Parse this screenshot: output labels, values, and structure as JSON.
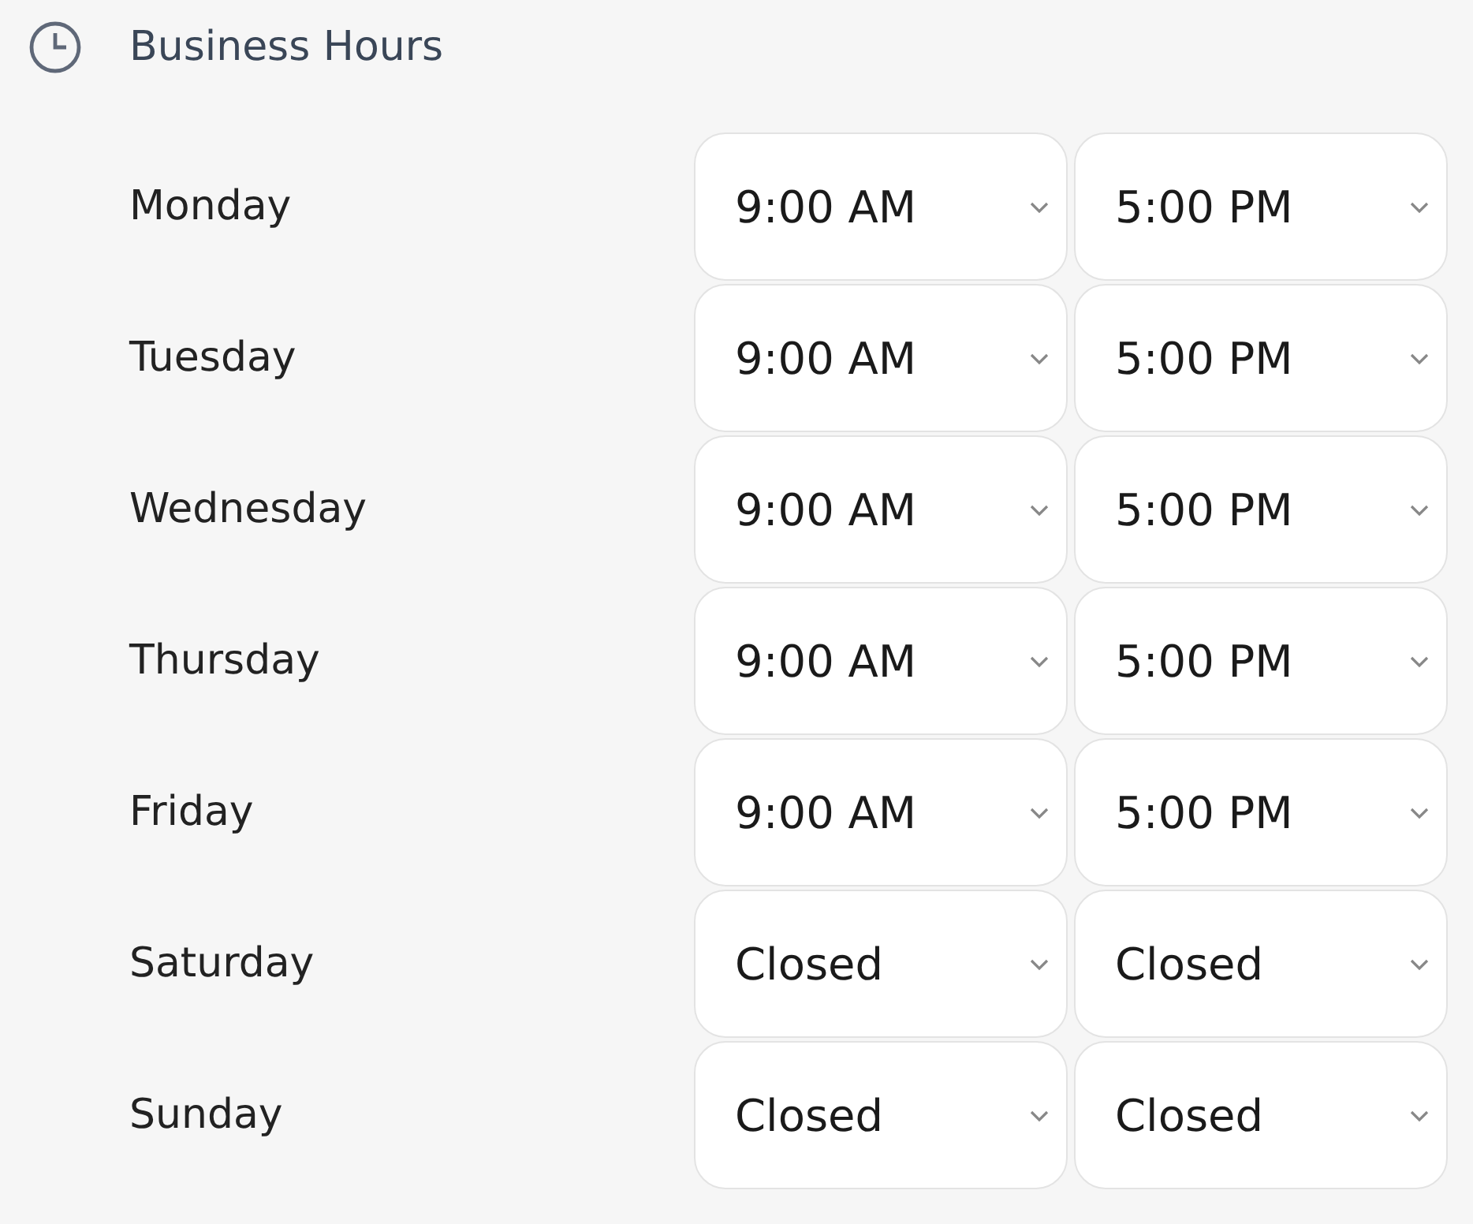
{
  "section": {
    "title": "Business Hours"
  },
  "days": [
    {
      "day": "Monday",
      "open": "9:00 AM",
      "close": "5:00 PM"
    },
    {
      "day": "Tuesday",
      "open": "9:00 AM",
      "close": "5:00 PM"
    },
    {
      "day": "Wednesday",
      "open": "9:00 AM",
      "close": "5:00 PM"
    },
    {
      "day": "Thursday",
      "open": "9:00 AM",
      "close": "5:00 PM"
    },
    {
      "day": "Friday",
      "open": "9:00 AM",
      "close": "5:00 PM"
    },
    {
      "day": "Saturday",
      "open": "Closed",
      "close": "Closed"
    },
    {
      "day": "Sunday",
      "open": "Closed",
      "close": "Closed"
    }
  ]
}
